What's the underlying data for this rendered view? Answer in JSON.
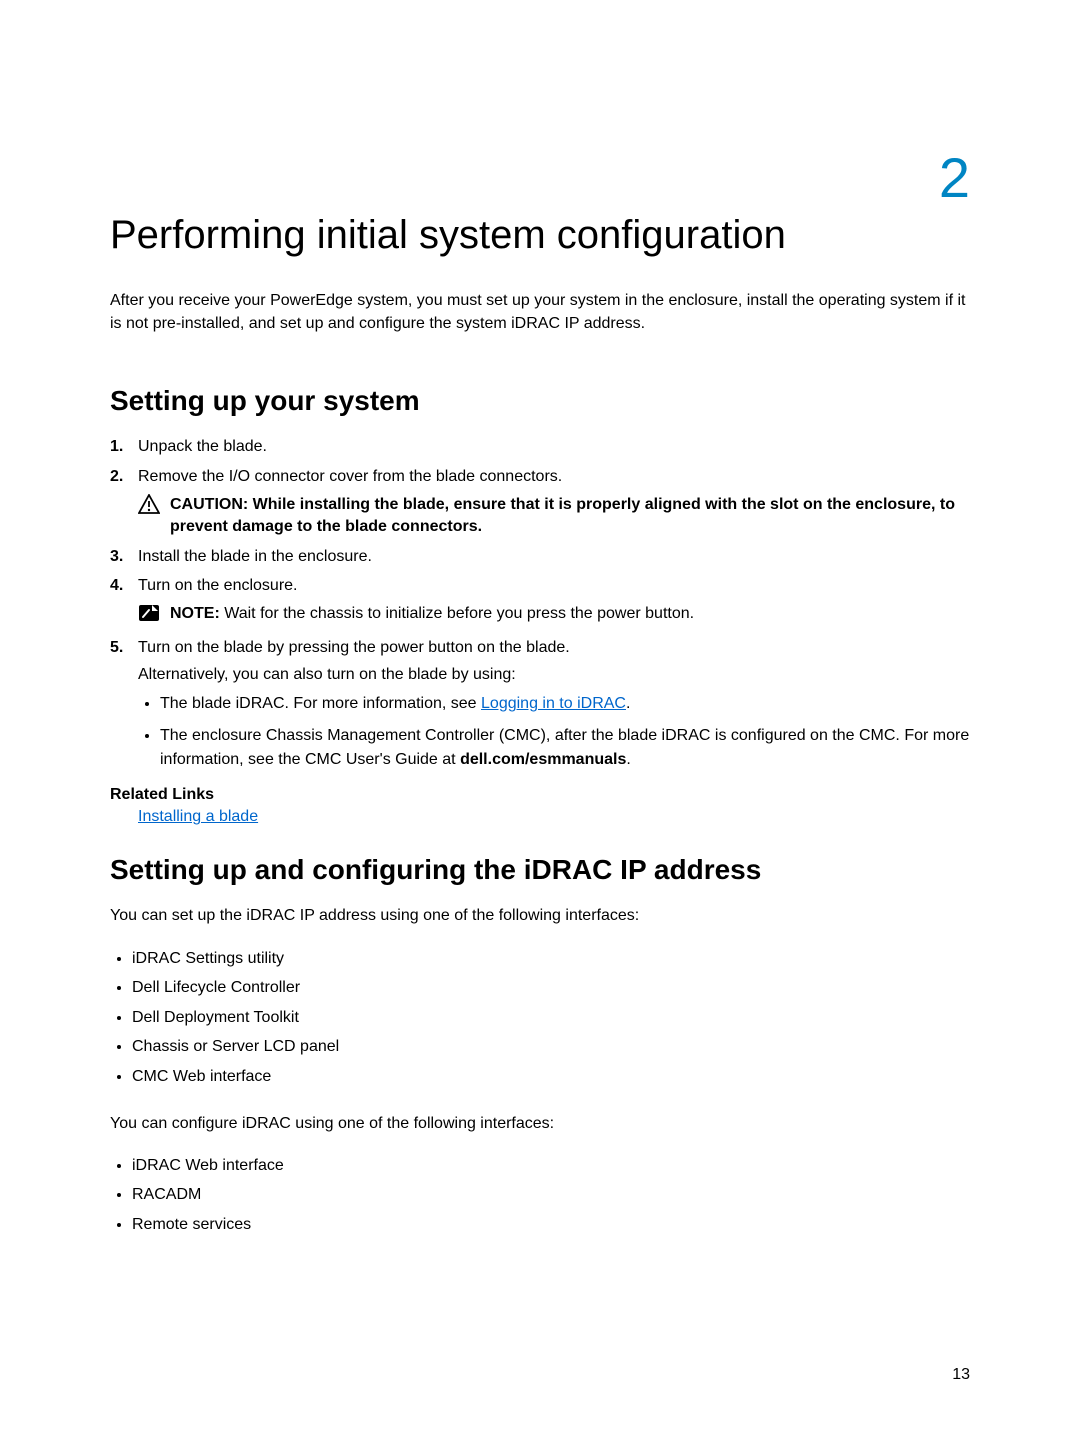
{
  "chapter": {
    "number": "2",
    "title": "Performing initial system configuration",
    "intro": "After you receive your PowerEdge system, you must set up your system in the enclosure, install the operating system if it is not pre-installed, and set up and configure the system iDRAC IP address."
  },
  "section1": {
    "title": "Setting up your system",
    "steps": {
      "s1": "Unpack the blade.",
      "s2": "Remove the I/O connector cover from the blade connectors.",
      "caution_prefix": "CAUTION: ",
      "caution_text": "While installing the blade, ensure that it is properly aligned with the slot on the enclosure, to prevent damage to the blade connectors.",
      "s3": "Install the blade in the enclosure.",
      "s4": "Turn on the enclosure.",
      "note_prefix": "NOTE: ",
      "note_text": "Wait for the chassis to initialize before you press the power button.",
      "s5_line1": "Turn on the blade by pressing the power button on the blade.",
      "s5_line2": "Alternatively, you can also turn on the blade by using:",
      "s5_b1_before": "The blade iDRAC. For more information, see ",
      "s5_b1_link": "Logging in to iDRAC",
      "s5_b1_after": ".",
      "s5_b2_before": "The enclosure Chassis Management Controller (CMC), after the blade iDRAC is configured on the CMC. For more information, see the CMC User's Guide at ",
      "s5_b2_bold": "dell.com/esmmanuals",
      "s5_b2_after": "."
    },
    "related_heading": "Related Links",
    "related_link": "Installing a blade"
  },
  "section2": {
    "title": "Setting up and configuring the iDRAC IP address",
    "para1": "You can set up the iDRAC IP address using one of the following interfaces:",
    "list1": {
      "i1": "iDRAC Settings utility",
      "i2": "Dell Lifecycle Controller",
      "i3": "Dell Deployment Toolkit",
      "i4": "Chassis or Server LCD panel",
      "i5": "CMC Web interface"
    },
    "para2": "You can configure iDRAC using one of the following interfaces:",
    "list2": {
      "i1": "iDRAC Web interface",
      "i2": "RACADM",
      "i3": "Remote services"
    }
  },
  "page_number": "13"
}
